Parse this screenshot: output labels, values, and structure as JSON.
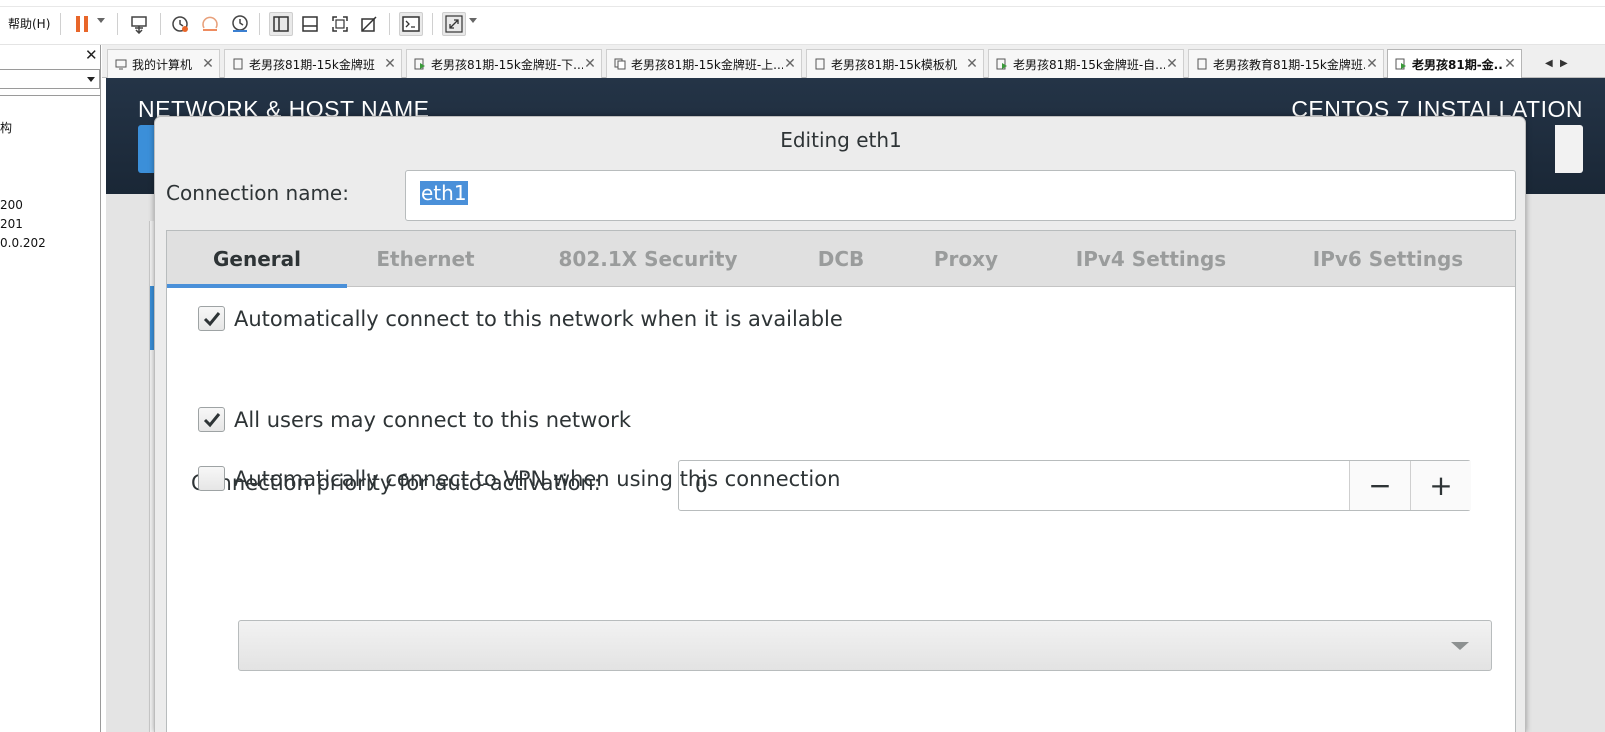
{
  "toolbar": {
    "help_menu": "帮助(H)"
  },
  "left_panel": {
    "tree_items": [
      "构",
      "200",
      "201",
      "0.0.202"
    ]
  },
  "tabs": [
    {
      "label": "我的计算机",
      "icon": "computer-icon",
      "active": false
    },
    {
      "label": "老男孩81期-15k金牌班",
      "icon": "vm-icon",
      "active": false
    },
    {
      "label": "老男孩81期-15k金牌班-下...",
      "icon": "vm-running-icon",
      "active": false
    },
    {
      "label": "老男孩81期-15k金牌班-上...",
      "icon": "vm-clone-icon",
      "active": false
    },
    {
      "label": "老男孩81期-15k模板机",
      "icon": "vm-icon",
      "active": false
    },
    {
      "label": "老男孩81期-15k金牌班-自...",
      "icon": "vm-running-icon",
      "active": false
    },
    {
      "label": "老男孩教育81期-15k金牌班...",
      "icon": "vm-icon",
      "active": false
    },
    {
      "label": "老男孩81期-金...",
      "icon": "vm-running-icon",
      "active": true
    }
  ],
  "installer": {
    "page_title": "NETWORK & HOST NAME",
    "product_title": "CENTOS 7 INSTALLATION"
  },
  "dialog": {
    "title": "Editing eth1",
    "connection_name_label": "Connection name:",
    "connection_name_value": "eth1",
    "tabs": [
      "General",
      "Ethernet",
      "802.1X Security",
      "DCB",
      "Proxy",
      "IPv4 Settings",
      "IPv6 Settings"
    ],
    "active_tab": "General",
    "general": {
      "auto_connect_label": "Automatically connect to this network when it is available",
      "auto_connect_checked": true,
      "priority_label": "Connection priority for auto-activation:",
      "priority_value": "0",
      "minus_label": "−",
      "plus_label": "+",
      "all_users_label": "All users may connect to this network",
      "all_users_checked": true,
      "vpn_label": "Automatically connect to VPN when using this connection",
      "vpn_checked": false,
      "vpn_selected": ""
    }
  },
  "colors": {
    "accent": "#4a90d9",
    "header_bg": "#1b2838",
    "dialog_bg": "#ececec",
    "pause_orange": "#e8662a"
  }
}
